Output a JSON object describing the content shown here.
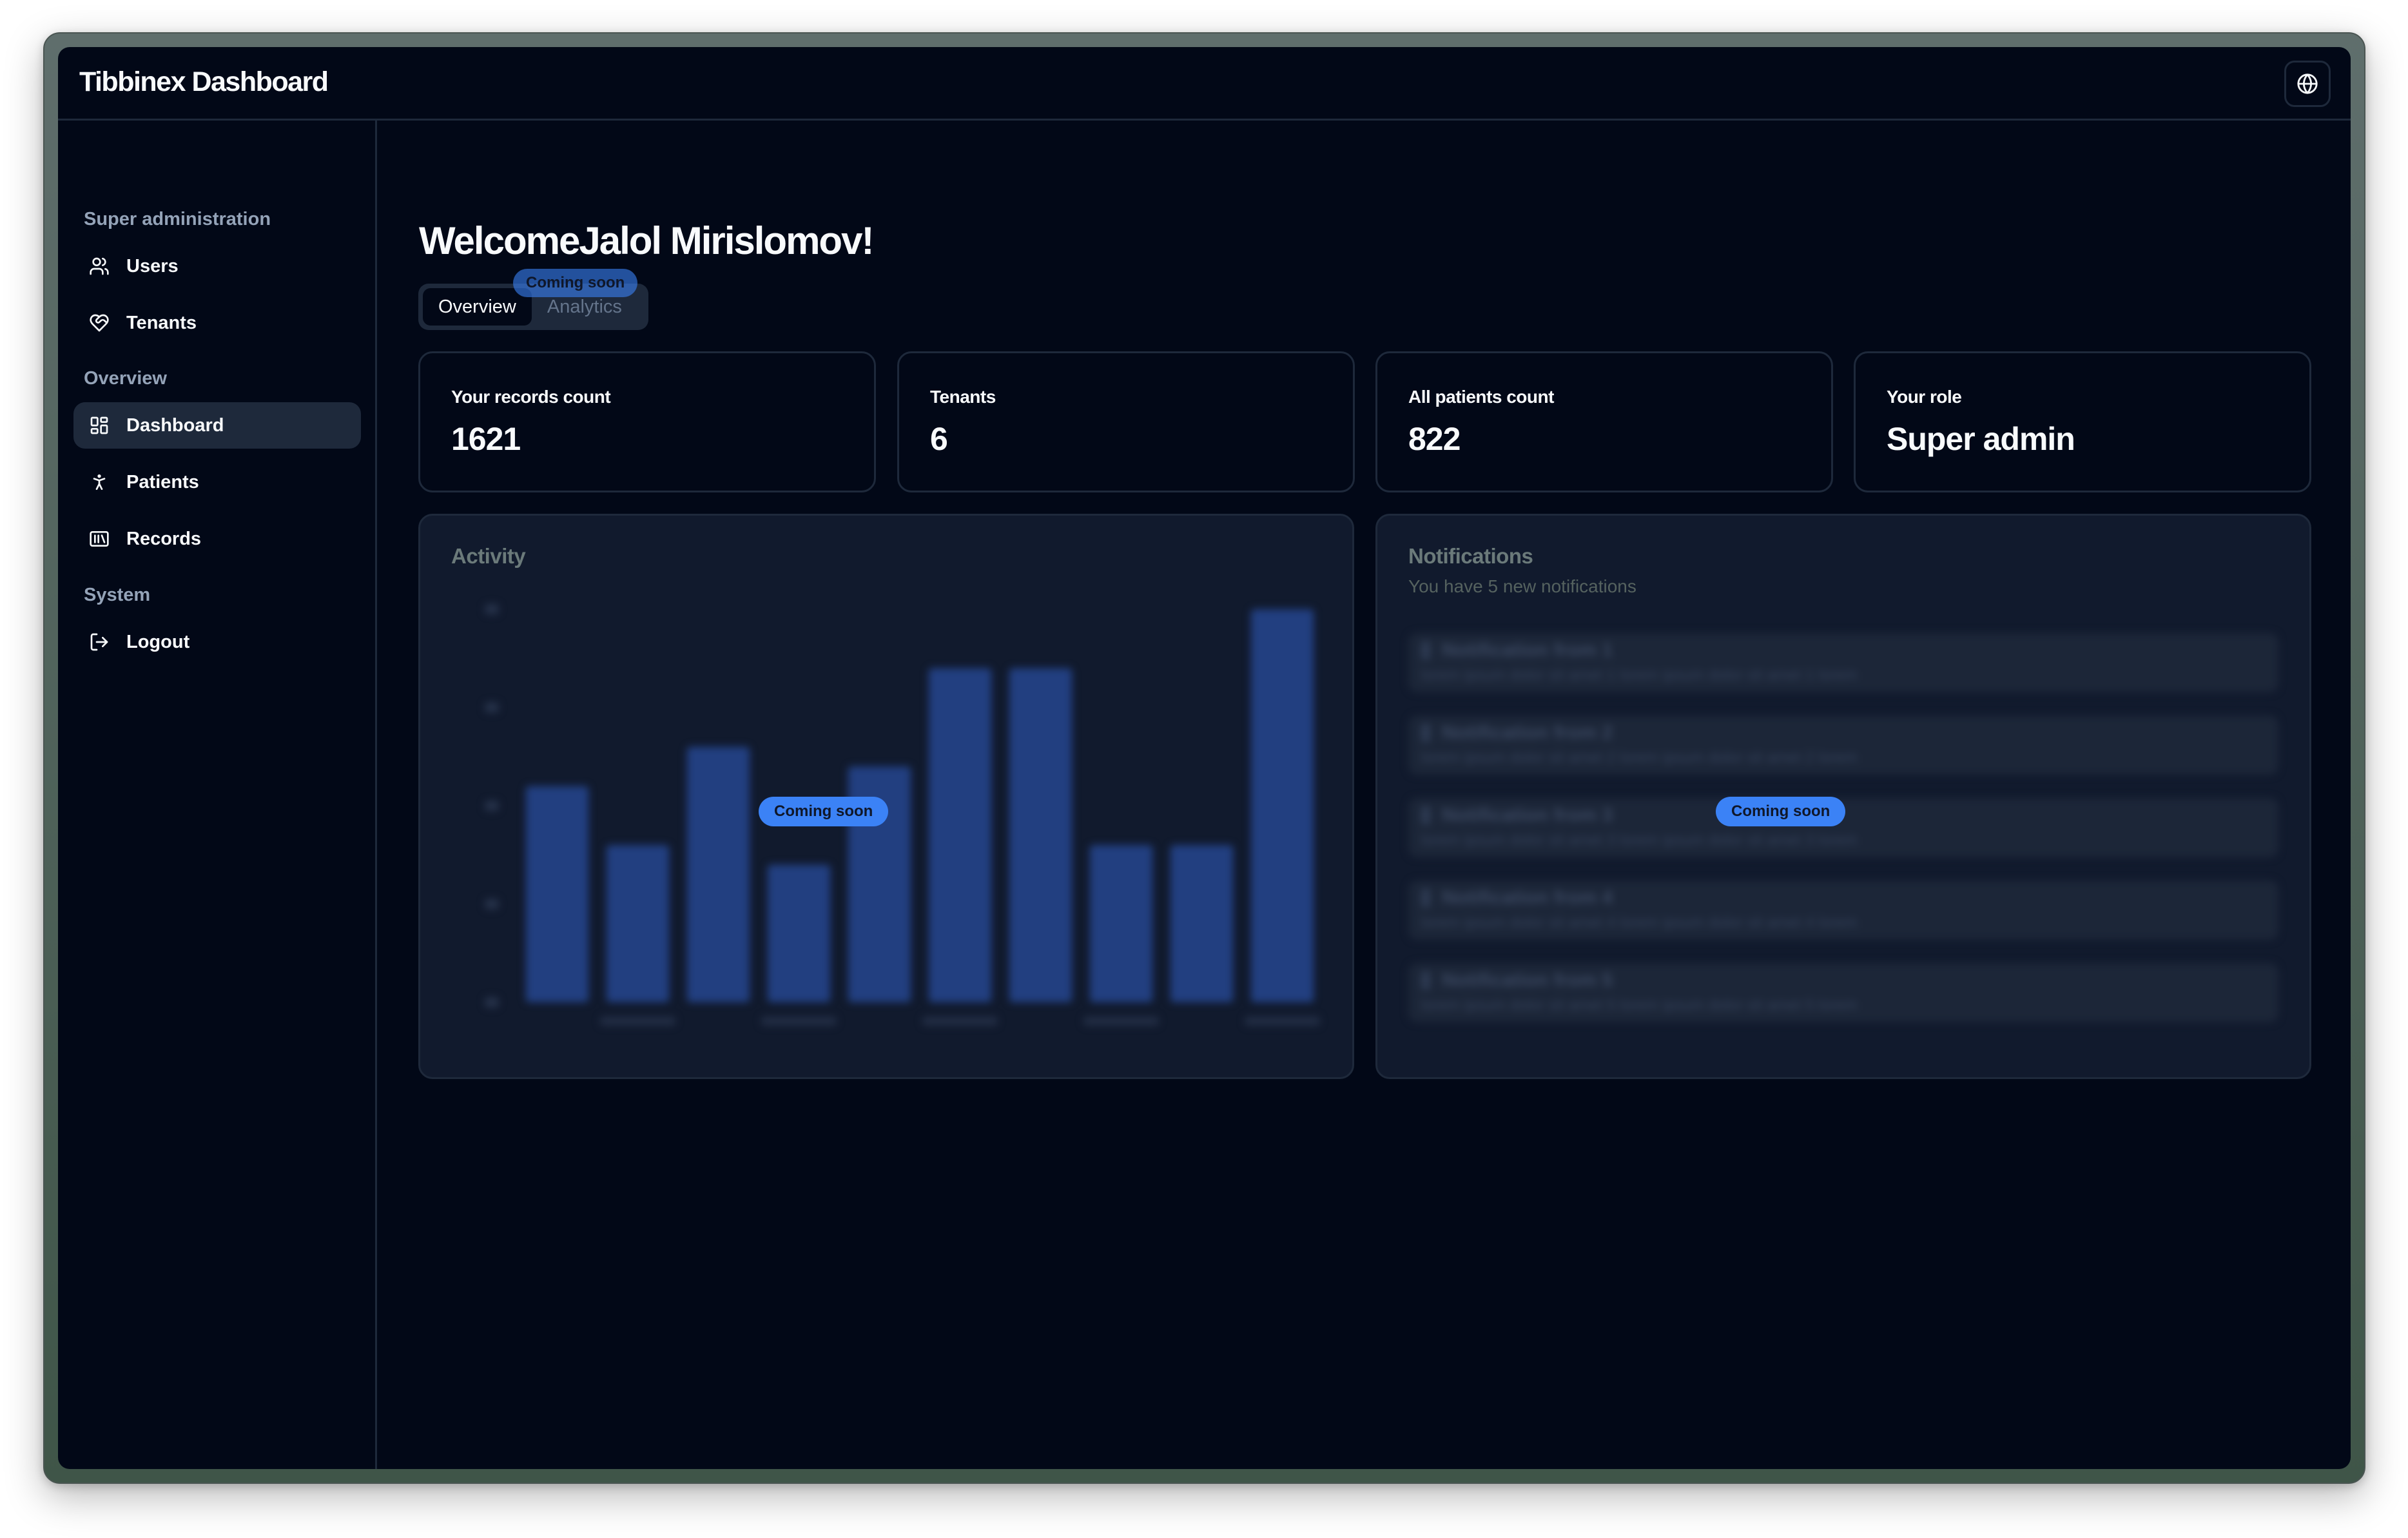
{
  "app": {
    "title": "Tibbinex Dashboard",
    "language_button_icon": "globe-icon"
  },
  "sidebar": {
    "sections": [
      {
        "label": "Super administration",
        "items": [
          {
            "label": "Users",
            "icon": "users-icon"
          },
          {
            "label": "Tenants",
            "icon": "handshake-heart-icon"
          }
        ]
      },
      {
        "label": "Overview",
        "items": [
          {
            "label": "Dashboard",
            "icon": "layout-dashboard-icon",
            "active": true
          },
          {
            "label": "Patients",
            "icon": "person-standing-icon"
          },
          {
            "label": "Records",
            "icon": "library-icon"
          }
        ]
      },
      {
        "label": "System",
        "items": [
          {
            "label": "Logout",
            "icon": "log-out-icon"
          }
        ]
      }
    ]
  },
  "main": {
    "welcome": "WelcomeJalol Mirislomov!",
    "tabs": [
      {
        "label": "Overview",
        "active": true
      },
      {
        "label": "Analytics",
        "disabled": true,
        "badge": "Coming soon"
      }
    ],
    "stats": [
      {
        "label": "Your records count",
        "value": "1621"
      },
      {
        "label": "Tenants",
        "value": "6"
      },
      {
        "label": "All patients count",
        "value": "822"
      },
      {
        "label": "Your role",
        "value": "Super admin"
      }
    ],
    "activity": {
      "title": "Activity",
      "badge": "Coming soon"
    },
    "notifications": {
      "title": "Notifications",
      "subtitle": "You have 5 new notifications",
      "badge": "Coming soon",
      "items": [
        {
          "title": "Notification from 1",
          "body": "lorem ipsum dolor sit amet 1 lorem ipsum dolor sit amet 1 lorem"
        },
        {
          "title": "Notification from 2",
          "body": "lorem ipsum dolor sit amet 2 lorem ipsum dolor sit amet 2 lorem"
        },
        {
          "title": "Notification from 3",
          "body": "lorem ipsum dolor sit amet 3 lorem ipsum dolor sit amet 3 lorem"
        },
        {
          "title": "Notification from 4",
          "body": "lorem ipsum dolor sit amet 4 lorem ipsum dolor sit amet 4 lorem"
        },
        {
          "title": "Notification from 5",
          "body": "lorem ipsum dolor sit amet 5 lorem ipsum dolor sit amet 5 lorem"
        }
      ]
    }
  },
  "colors": {
    "background": "#020817",
    "border": "#1e293b",
    "panel": "#111a2d",
    "bar": "#223f80",
    "accent": "#3b82f6"
  },
  "chart_data": {
    "type": "bar",
    "title": "Activity",
    "categories": [
      "",
      "",
      "",
      "",
      "",
      "",
      "",
      "",
      "",
      ""
    ],
    "values": [
      11,
      8,
      13,
      7,
      12,
      17,
      17,
      8,
      8,
      20
    ],
    "ylim": [
      0,
      20
    ],
    "yticks": [
      0,
      5,
      10,
      15,
      20
    ],
    "xlabel": "",
    "ylabel": "",
    "grid": false,
    "legend": "none",
    "note": "chart content is blurred in the UI; values estimated from bar heights"
  }
}
